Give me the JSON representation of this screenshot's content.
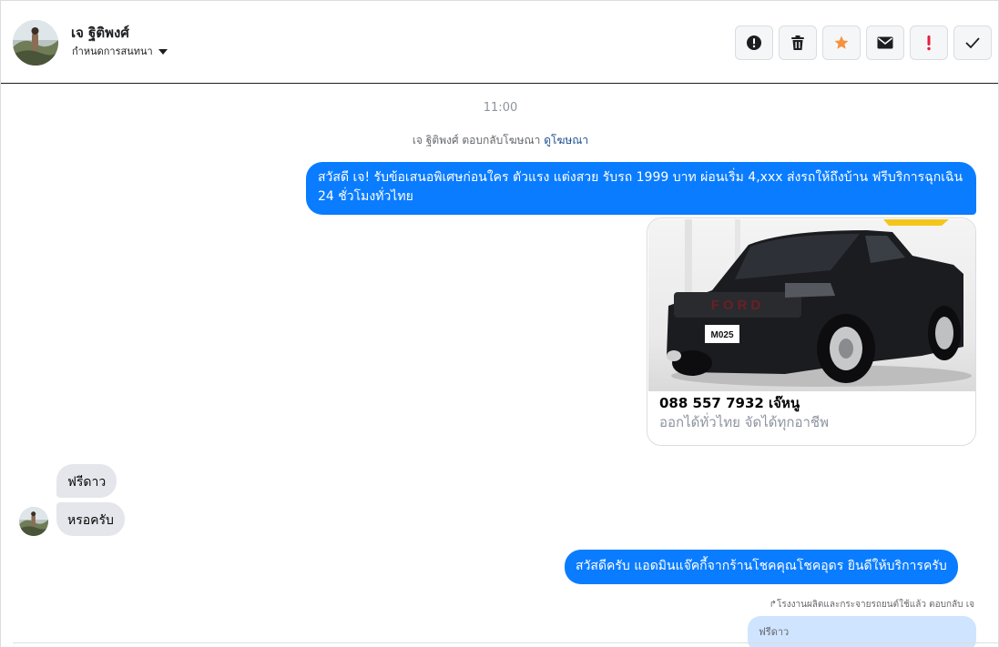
{
  "header": {
    "contact_name": "เจ ฐิติพงศ์",
    "assign_label": "กำหนดการสนทนา",
    "actions": [
      "mark-spam",
      "delete",
      "star",
      "mark-unread",
      "important",
      "done"
    ]
  },
  "conversation": {
    "timestamp": "11:00",
    "ad_reply_text": "เจ ฐิติพงศ์ ตอบกลับโฆษณา",
    "ad_reply_link": "ดูโฆษณา",
    "outgoing_1": "สวัสดี เจ! รับข้อเสนอพิเศษก่อนใคร ตัวแรง แต่งสวย รับรถ 1999 บาท ผ่อนเริ่ม 4,xxx ส่งรถให้ถึงบ้าน ฟรีบริการฉุกเฉิน 24 ชั่วโมงทั่วไทย",
    "ad_card": {
      "title": "088 557 7932 เจ๊หนู",
      "subtitle": "ออกได้ทั่วไทย จัดได้ทุกอาชีพ",
      "plate_text": "M025",
      "grille_text": "FORD"
    },
    "incoming_1": "ฟรีดาว",
    "incoming_2": "หรอครับ",
    "outgoing_2": "สวัสดีครับ แอดมินแจ๊คกี้จากร้านโชคคุณโชคอุดร ยินดีให้บริการครับ",
    "reply_note": "โรงงานผลิตและกระจายรถยนต์ใช้แล้ว ตอบกลับ เจ",
    "quoted_text": "ฟรีดาว"
  },
  "colors": {
    "outgoing_bubble": "#0a7cff",
    "incoming_bubble": "#e4e6eb",
    "star": "#f5923e",
    "important": "#e41e3f"
  }
}
